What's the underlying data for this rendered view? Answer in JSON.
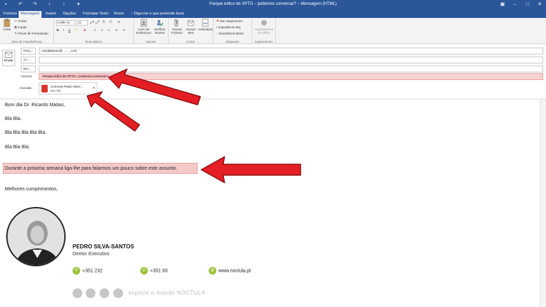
{
  "window": {
    "title": "Parque eólico de XPTO – podemos conversar? – Mensagem (HTML)"
  },
  "tabs": [
    {
      "label": "Ficheiro"
    },
    {
      "label": "Mensagem"
    },
    {
      "label": "Inserir"
    },
    {
      "label": "Opções"
    },
    {
      "label": "Formatar Texto"
    },
    {
      "label": "Rever"
    }
  ],
  "tell_me": "Diga-me o que pretende fazer",
  "ribbon": {
    "clipboard": {
      "paste": "Colar",
      "cut": "Cortar",
      "copy": "Copiar",
      "format_painter": "Pincel de Formatação",
      "group": "Área de Transferência"
    },
    "basic_text": {
      "font": "Calibri (C",
      "size": "11",
      "group": "Texto Básico"
    },
    "names": {
      "address_book": "Livro de Endereços",
      "check_names": "Verificar Nomes",
      "group": "Nomes"
    },
    "include": {
      "attach_file": "Anexar Ficheiro",
      "attach_item": "Anexar Item",
      "signature": "Assinatura",
      "group": "Incluir"
    },
    "tags": {
      "follow_up": "Dar Seguimento",
      "high": "Importância Alta",
      "low": "Importância Baixa",
      "group": "Etiquetas"
    },
    "addins": {
      "office_addins": "Suplementos do Office",
      "group": "Suplementos"
    }
  },
  "header": {
    "send": "Enviar",
    "to_label": "Para...",
    "to_value": "candidaturas@..........com",
    "cc_label": "Cc...",
    "bcc_label": "Bcc...",
    "subject_label": "Assunto",
    "subject_value": "Parque eólico de XPTO – podemos conversar?",
    "attached_label": "Anexado",
    "attachment_name": "Curriculo-Pedro-Silva-...",
    "attachment_size": "661 KB"
  },
  "body": {
    "greeting": "Bom dia Dr. Ricardo Matias,",
    "l1": "Bla Bla.",
    "l2": "Bla Bla Bla Bla Bla.",
    "l3": "Bla Bla Bla.",
    "highlight": "Durante a próxima semana ligo-lhe para falarmos um pouco sobre este assunto.",
    "closing": "Melhores cumprimentos,"
  },
  "signature": {
    "name": "PEDRO SILVA-SANTOS",
    "title": "Diretor Executivo",
    "phone1": "+351 232",
    "phone2": "+351 93",
    "website": "www.noctula.pt",
    "tagline": "explore o mundo NOCTULA"
  },
  "colors": {
    "accent": "#2b579a",
    "arrow": "#e31e24",
    "highlight": "#f4c9c9",
    "signature_icon": "#9cc23a"
  }
}
